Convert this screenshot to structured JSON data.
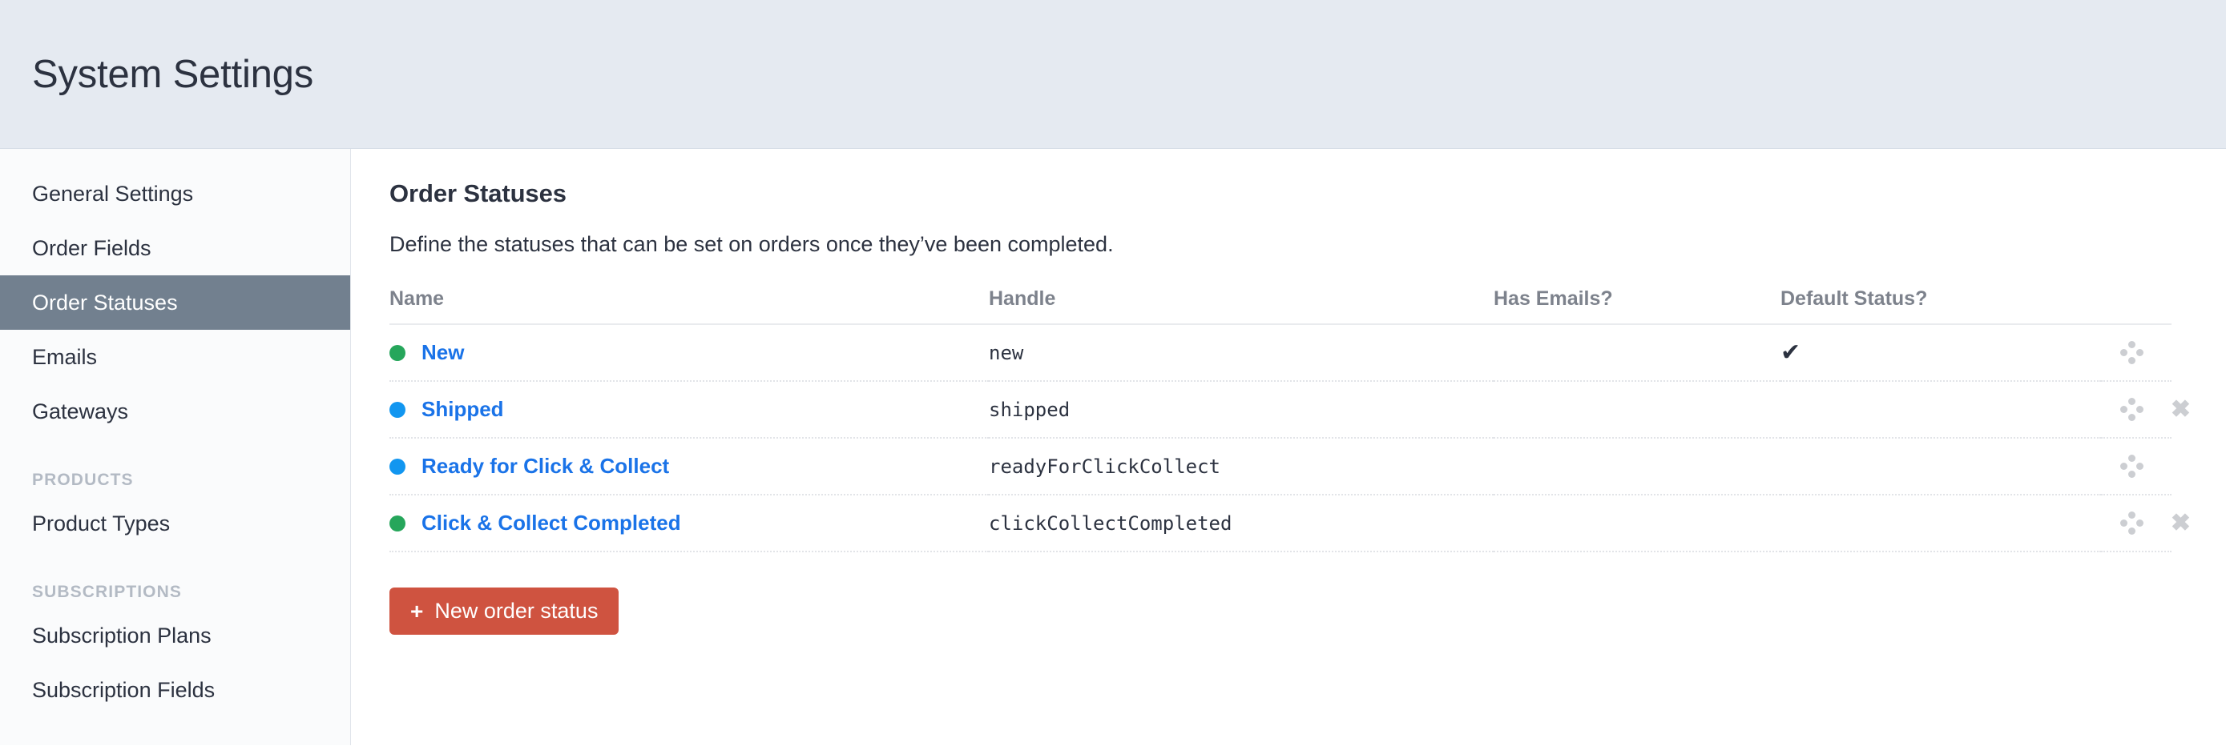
{
  "header": {
    "title": "System Settings"
  },
  "sidebar": {
    "items": [
      {
        "label": "General Settings",
        "active": false
      },
      {
        "label": "Order Fields",
        "active": false
      },
      {
        "label": "Order Statuses",
        "active": true
      },
      {
        "label": "Emails",
        "active": false
      },
      {
        "label": "Gateways",
        "active": false
      }
    ],
    "sections": [
      {
        "heading": "PRODUCTS",
        "items": [
          {
            "label": "Product Types",
            "active": false
          }
        ]
      },
      {
        "heading": "SUBSCRIPTIONS",
        "items": [
          {
            "label": "Subscription Plans",
            "active": false
          },
          {
            "label": "Subscription Fields",
            "active": false
          }
        ]
      }
    ]
  },
  "main": {
    "title": "Order Statuses",
    "description": "Define the statuses that can be set on orders once they’ve been completed.",
    "table": {
      "columns": {
        "name": "Name",
        "handle": "Handle",
        "has_emails": "Has Emails?",
        "default_status": "Default Status?"
      },
      "rows": [
        {
          "name": "New",
          "handle": "new",
          "dot_color": "#26a65b",
          "has_emails": "",
          "default_status": "✔",
          "deletable": false
        },
        {
          "name": "Shipped",
          "handle": "shipped",
          "dot_color": "#1296f0",
          "has_emails": "",
          "default_status": "",
          "deletable": true
        },
        {
          "name": "Ready for Click & Collect",
          "handle": "readyForClickCollect",
          "dot_color": "#1296f0",
          "has_emails": "",
          "default_status": "",
          "deletable": false
        },
        {
          "name": "Click & Collect Completed",
          "handle": "clickCollectCompleted",
          "dot_color": "#26a65b",
          "has_emails": "",
          "default_status": "",
          "deletable": true
        }
      ]
    },
    "new_button": {
      "label": "New order status",
      "icon": "plus-icon",
      "color": "#cf5340"
    }
  },
  "colors": {
    "header_bg": "#e5eaf1",
    "sidebar_bg": "#fafbfc",
    "active_nav_bg": "#72808f",
    "link": "#1a73e8",
    "text": "#2c3240",
    "muted": "#7d828c"
  }
}
